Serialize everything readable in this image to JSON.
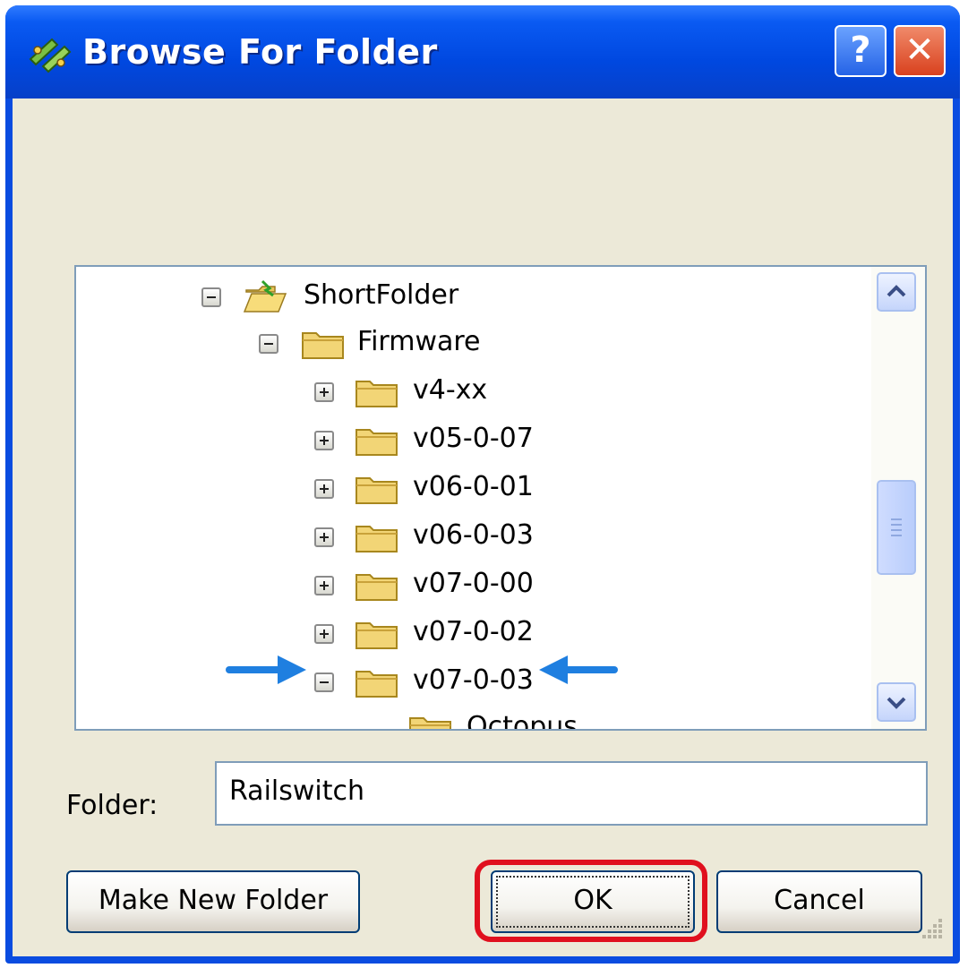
{
  "window": {
    "title": "Browse For Folder",
    "help_label": "?",
    "close_label": "✕"
  },
  "tree": {
    "items": [
      {
        "label": "ShortFolder",
        "expander": "minus",
        "special": true
      },
      {
        "label": "Firmware",
        "expander": "minus"
      },
      {
        "label": "v4-xx",
        "expander": "plus"
      },
      {
        "label": "v05-0-07",
        "expander": "plus"
      },
      {
        "label": "v06-0-01",
        "expander": "plus"
      },
      {
        "label": "v06-0-03",
        "expander": "plus"
      },
      {
        "label": "v07-0-00",
        "expander": "plus"
      },
      {
        "label": "v07-0-02",
        "expander": "plus"
      },
      {
        "label": "v07-0-03",
        "expander": "minus",
        "highlighted_by_arrows": true
      },
      {
        "label": "Octopus",
        "expander": "none"
      }
    ]
  },
  "folder_field": {
    "label": "Folder:",
    "value": "Railswitch"
  },
  "buttons": {
    "make_new_folder": "Make New Folder",
    "ok": "OK",
    "cancel": "Cancel"
  },
  "colors": {
    "title_bar": "#0a4ce0",
    "arrow": "#1f7fe0",
    "highlight_ring": "#e0101e",
    "dialog_bg": "#ece9d8"
  }
}
